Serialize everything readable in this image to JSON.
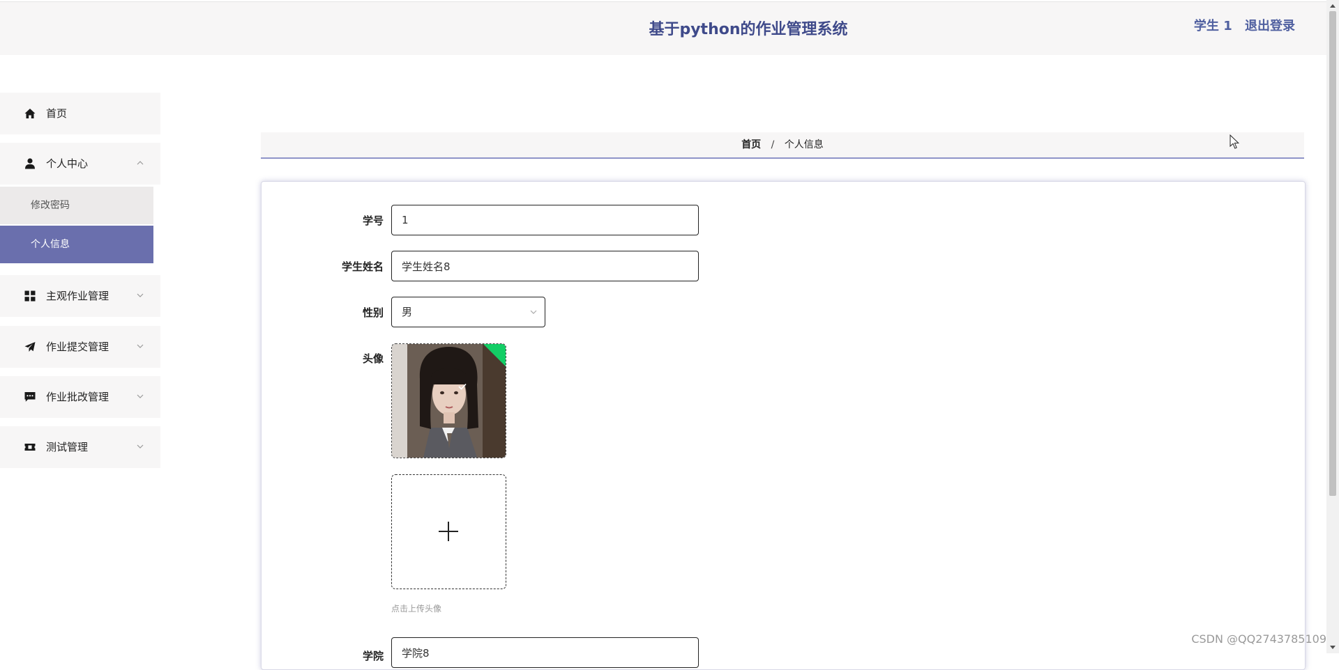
{
  "header": {
    "title": "基于python的作业管理系统",
    "user_label": "学生 1",
    "logout_label": "退出登录"
  },
  "sidebar": {
    "items": [
      {
        "label": "首页",
        "icon": "home-icon"
      },
      {
        "label": "个人中心",
        "icon": "user-icon",
        "expanded": true,
        "children": [
          {
            "label": "修改密码"
          },
          {
            "label": "个人信息",
            "active": true
          }
        ]
      },
      {
        "label": "主观作业管理",
        "icon": "grid-icon"
      },
      {
        "label": "作业提交管理",
        "icon": "paper-plane-icon"
      },
      {
        "label": "作业批改管理",
        "icon": "comment-icon"
      },
      {
        "label": "测试管理",
        "icon": "ticket-icon"
      }
    ]
  },
  "breadcrumb": {
    "home": "首页",
    "separator": "/",
    "current": "个人信息"
  },
  "form": {
    "student_id_label": "学号",
    "student_id_value": "1",
    "student_name_label": "学生姓名",
    "student_name_value": "学生姓名8",
    "gender_label": "性别",
    "gender_value": "男",
    "avatar_label": "头像",
    "upload_hint": "点击上传头像",
    "college_label": "学院",
    "college_value": "学院8"
  },
  "watermark": "CSDN @QQ2743785109",
  "colors": {
    "accent": "#6a6fad",
    "title": "#3f4a8a",
    "success": "#13ce66"
  }
}
